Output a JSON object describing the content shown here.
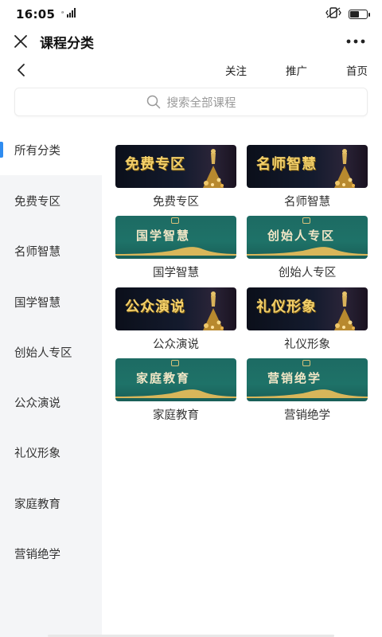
{
  "status_bar": {
    "time": "16:05",
    "signal_text": "ᵃll",
    "battery_level": 0.6
  },
  "title_bar": {
    "title": "课程分类",
    "close_icon": "close-icon",
    "more_icon": "more-icon"
  },
  "web_nav": {
    "back_icon": "chevron-left-icon",
    "links": [
      "关注",
      "推广",
      "首页"
    ]
  },
  "search": {
    "placeholder": "搜索全部课程",
    "icon": "search-icon"
  },
  "sidebar": {
    "items": [
      {
        "label": "所有分类",
        "active": true
      },
      {
        "label": "免费专区",
        "active": false
      },
      {
        "label": "名师智慧",
        "active": false
      },
      {
        "label": "国学智慧",
        "active": false
      },
      {
        "label": "创始人专区",
        "active": false
      },
      {
        "label": "公众演说",
        "active": false
      },
      {
        "label": "礼仪形象",
        "active": false
      },
      {
        "label": "家庭教育",
        "active": false
      },
      {
        "label": "营销绝学",
        "active": false
      }
    ]
  },
  "categories": [
    {
      "label": "免费专区",
      "banner": "免费专区",
      "style": "dark"
    },
    {
      "label": "名师智慧",
      "banner": "名师智慧",
      "style": "dark"
    },
    {
      "label": "国学智慧",
      "banner": "国学智慧",
      "style": "green"
    },
    {
      "label": "创始人专区",
      "banner": "创始人专区",
      "style": "green"
    },
    {
      "label": "公众演说",
      "banner": "公众演说",
      "style": "dark"
    },
    {
      "label": "礼仪形象",
      "banner": "礼仪形象",
      "style": "dark"
    },
    {
      "label": "家庭教育",
      "banner": "家庭教育",
      "style": "green"
    },
    {
      "label": "营销绝学",
      "banner": "营销绝学",
      "style": "green"
    }
  ],
  "colors": {
    "accent": "#2f8cf0",
    "sidebar_bg": "#f4f5f7",
    "banner_gold": "#f3d06a",
    "banner_green": "#1d6b63"
  }
}
